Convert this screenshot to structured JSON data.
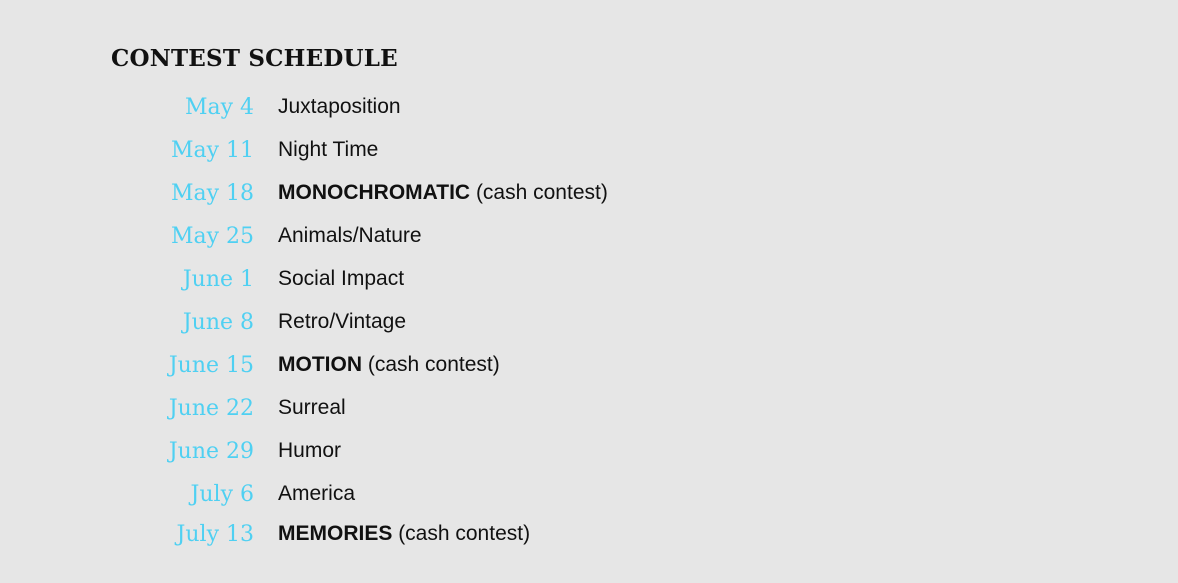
{
  "title": "CONTEST SCHEDULE",
  "accent_color": "#4fd0f2",
  "schedule": [
    {
      "date": "May 4",
      "topic": "Juxtaposition",
      "note": ""
    },
    {
      "date": "May 11",
      "topic": "Night Time",
      "note": ""
    },
    {
      "date": "May 18",
      "topic": "MONOCHROMATIC",
      "note": "(cash contest)"
    },
    {
      "date": "May 25",
      "topic": "Animals/Nature",
      "note": ""
    },
    {
      "date": "June 1",
      "topic": "Social Impact",
      "note": ""
    },
    {
      "date": "June 8",
      "topic": "Retro/Vintage",
      "note": ""
    },
    {
      "date": "June 15",
      "topic": "MOTION",
      "note": "(cash contest)"
    },
    {
      "date": "June 22",
      "topic": "Surreal",
      "note": ""
    },
    {
      "date": "June 29",
      "topic": "Humor",
      "note": ""
    },
    {
      "date": "July 6",
      "topic": "America",
      "note": ""
    },
    {
      "date": "July 13",
      "topic": "MEMORIES",
      "note": "(cash contest)"
    }
  ]
}
